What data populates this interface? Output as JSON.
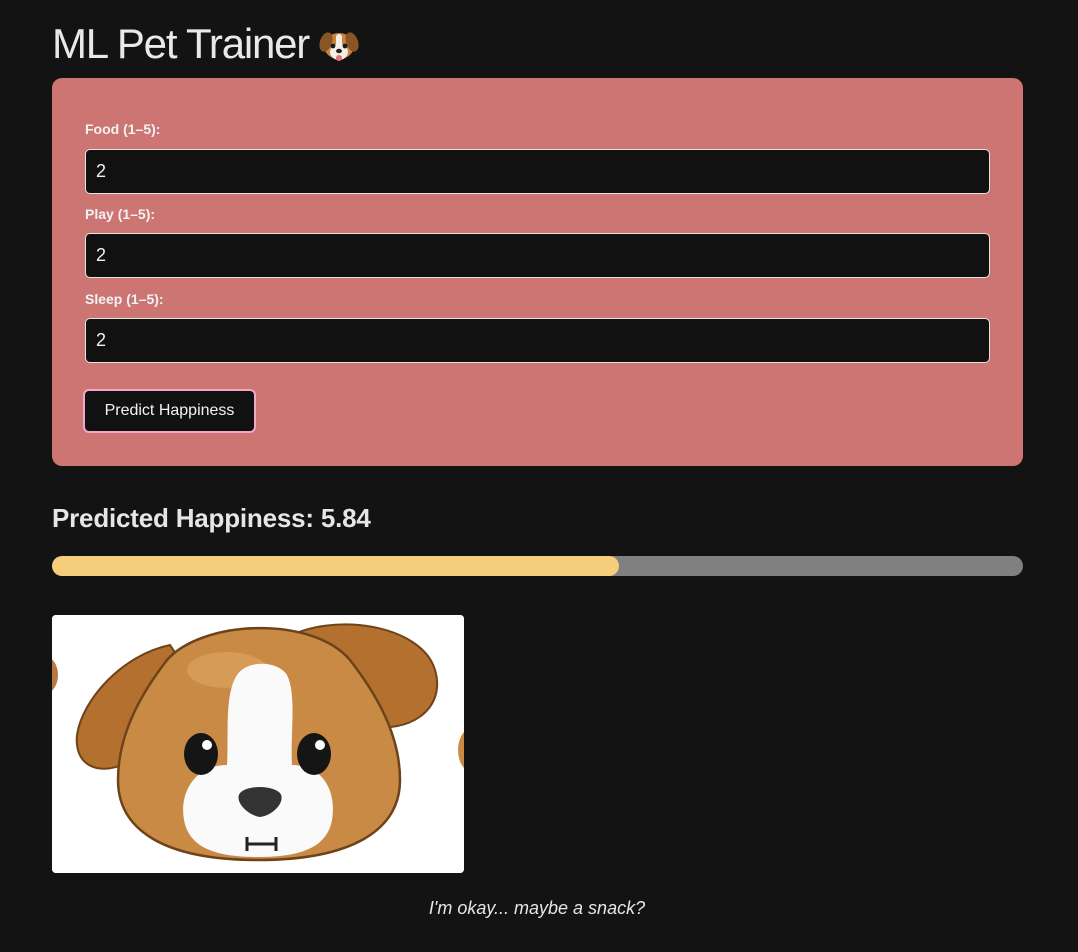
{
  "app": {
    "title": "ML Pet Trainer",
    "title_icon": "dog-face-icon"
  },
  "form": {
    "background_color": "#cc7573",
    "fields": [
      {
        "label": "Food (1–5):",
        "value": "2"
      },
      {
        "label": "Play (1–5):",
        "value": "2"
      },
      {
        "label": "Sleep (1–5):",
        "value": "2"
      }
    ],
    "submit_label": "Predict Happiness"
  },
  "result": {
    "heading": "Predicted Happiness: 5.84",
    "happiness_fraction": 0.584,
    "bar_fill_color": "#f6cd7b",
    "bar_track_color": "#808080",
    "pet_image_icon": "dog-face-icon",
    "message": "I'm okay... maybe a snack?"
  }
}
